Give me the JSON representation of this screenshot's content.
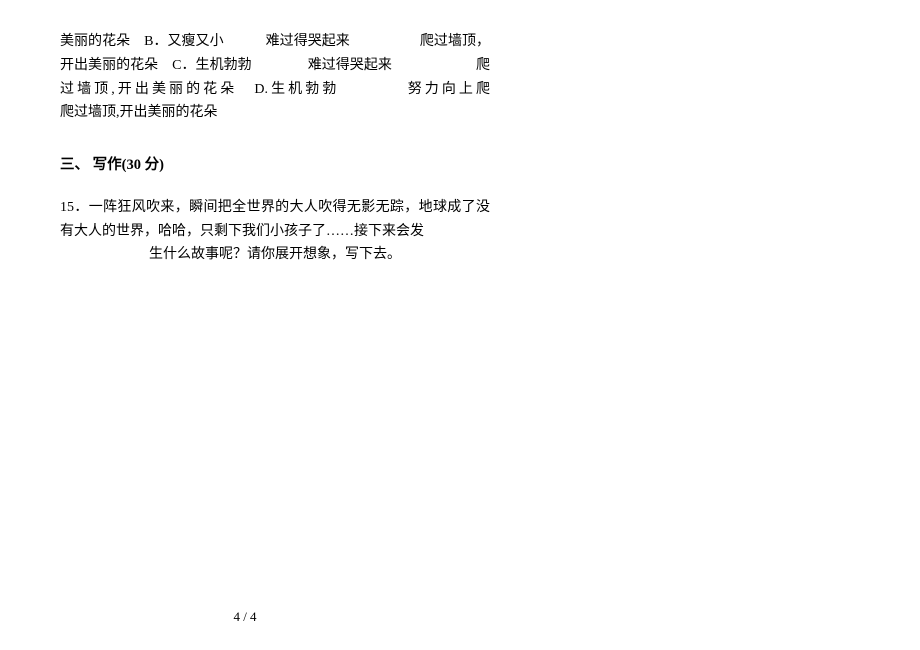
{
  "topParagraph": "美丽的花朵　B．又瘦又小　　　难过得哭起来　　　　　爬过墙顶，开出美丽的花朵　C．生机勃勃　　　　难过得哭起来　　　　　　爬过墙顶,开出美丽的花朵　D.生机勃勃　　　　努力向上爬　　　　　　爬过墙顶,开出美丽的花朵",
  "sectionHeading": "三、 写作(30 分)",
  "questionLine1": "15．一阵狂风吹来，瞬间把全世界的大人吹得无影无踪，地球成了没有大人的世界，哈哈，只剩下我们小孩子了……接下来会发",
  "questionLine2": "生什么故事呢？请你展开想象，写下去。",
  "pageNumber": "4 / 4"
}
